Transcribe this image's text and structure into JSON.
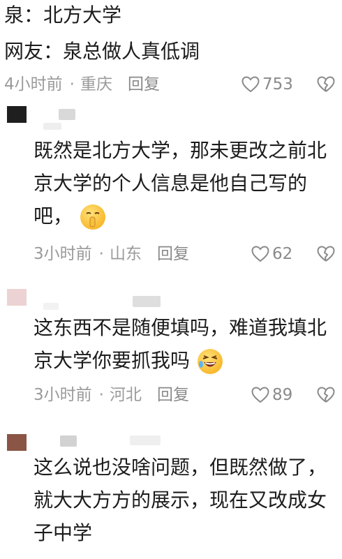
{
  "header": {
    "line1": "泉：北方大学",
    "line2": "网友：泉总做人真低调"
  },
  "top_meta": {
    "time": "4小时前",
    "location": "重庆",
    "reply": "回复",
    "likes": "753"
  },
  "comments": [
    {
      "text_lines": [
        "既然是北方大学，那未更改之前北",
        "京大学的个人信息是他自己写的",
        "吧，"
      ],
      "emoji": "shushing-face",
      "time": "3小时前",
      "location": "山东",
      "reply": "回复",
      "likes": "62",
      "avatar_color": "#1f1f1f"
    },
    {
      "text_lines": [
        "这东西不是随便填吗，难道我填北",
        "京大学你要抓我吗"
      ],
      "emoji": "rolling-on-floor-laughing",
      "time": "3小时前",
      "location": "河北",
      "reply": "回复",
      "likes": "89",
      "avatar_color": "#e6c8c8"
    },
    {
      "text_lines": [
        "这么说也没啥问题，但既然做了，",
        "就大大方方的展示，现在又改成女",
        "子中学"
      ],
      "time": "",
      "location": "",
      "reply": "",
      "likes": "",
      "avatar_color": "#8a5544"
    }
  ],
  "colors": {
    "meta_gray": "#9a9a9a",
    "text": "#1c1c1c"
  },
  "icons": {
    "like": "heart-outline-icon",
    "dislike": "broken-heart-outline-icon"
  }
}
